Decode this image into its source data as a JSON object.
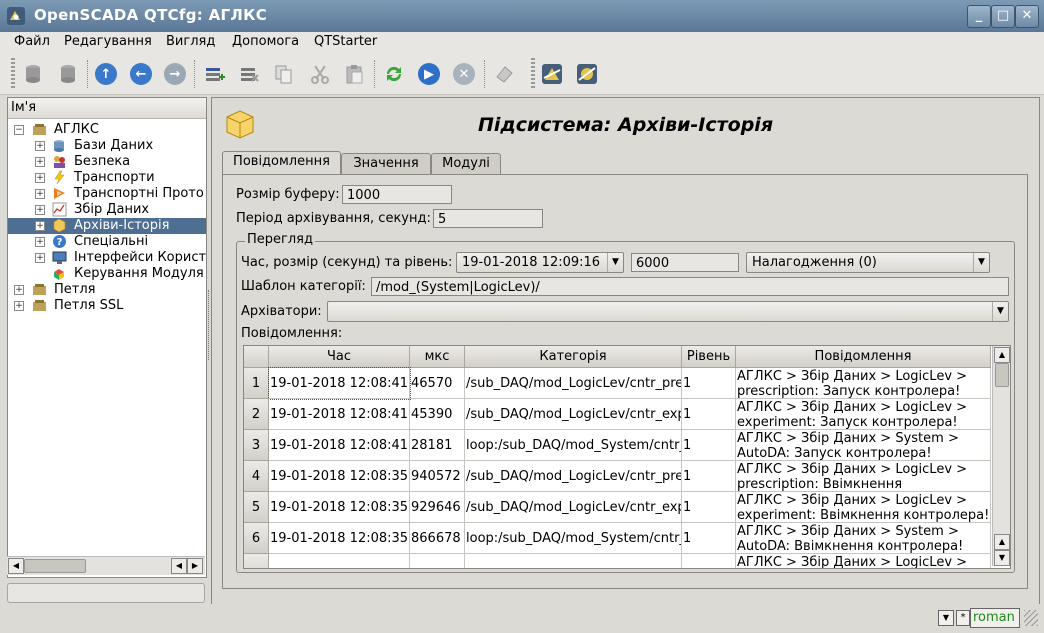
{
  "window": {
    "title": "OpenSCADA QTCfg: АГЛКС"
  },
  "menu": [
    "Файл",
    "Редагування",
    "Вигляд",
    "Допомога",
    "QTStarter"
  ],
  "tree": {
    "header": "Ім'я",
    "items": [
      {
        "label": "АГЛКС",
        "level": 0
      },
      {
        "label": "Бази Даних",
        "level": 1
      },
      {
        "label": "Безпека",
        "level": 1
      },
      {
        "label": "Транспорти",
        "level": 1
      },
      {
        "label": "Транспортні Прото",
        "level": 1
      },
      {
        "label": "Збір Даних",
        "level": 1
      },
      {
        "label": "Архіви-Історія",
        "level": 1,
        "selected": true
      },
      {
        "label": "Спеціальні",
        "level": 1
      },
      {
        "label": "Інтерфейси Корист",
        "level": 1
      },
      {
        "label": "Керування Модуля",
        "level": 1
      },
      {
        "label": "Петля",
        "level": 0
      },
      {
        "label": "Петля SSL",
        "level": 0
      }
    ]
  },
  "page": {
    "title": "Підсистема: Архіви-Історія",
    "tabs": [
      "Повідомлення",
      "Значення",
      "Модулі"
    ],
    "buffer_label": "Розмір буферу:",
    "buffer_value": "1000",
    "period_label": "Період архівування, секунд:",
    "period_value": "5",
    "view_group": "Перегляд",
    "time_label": "Час, розмір (секунд) та рівень:",
    "time_value": "19-01-2018 12:09:16",
    "size_value": "6000",
    "level_value": "Налагодження (0)",
    "category_label": "Шаблон категорії:",
    "category_value": "/mod_(System|LogicLev)/",
    "archivers_label": "Архіватори:",
    "archivers_value": "",
    "messages_label": "Повідомлення:"
  },
  "table": {
    "columns": [
      "Час",
      "мкс",
      "Категорія",
      "Рівень",
      "Повідомлення"
    ],
    "rows": [
      {
        "n": "1",
        "time": "19-01-2018 12:08:41",
        "us": "46570",
        "cat": "/sub_DAQ/mod_LogicLev/cntr_pre",
        "level": "1",
        "msg": "АГЛКС > Збір Даних > LogicLev > prescription: Запуск контролера!"
      },
      {
        "n": "2",
        "time": "19-01-2018 12:08:41",
        "us": "45390",
        "cat": "/sub_DAQ/mod_LogicLev/cntr_exp",
        "level": "1",
        "msg": "АГЛКС > Збір Даних > LogicLev > experiment: Запуск контролера!"
      },
      {
        "n": "3",
        "time": "19-01-2018 12:08:41",
        "us": "28181",
        "cat": "loop:/sub_DAQ/mod_System/cntr_",
        "level": "1",
        "msg": "АГЛКС > Збір Даних > System > AutoDA: Запуск контролера!"
      },
      {
        "n": "4",
        "time": "19-01-2018 12:08:35",
        "us": "940572",
        "cat": "/sub_DAQ/mod_LogicLev/cntr_pre",
        "level": "1",
        "msg": "АГЛКС > Збір Даних > LogicLev > prescription: Ввімкнення контролера!"
      },
      {
        "n": "5",
        "time": "19-01-2018 12:08:35",
        "us": "929646",
        "cat": "/sub_DAQ/mod_LogicLev/cntr_exp",
        "level": "1",
        "msg": "АГЛКС > Збір Даних > LogicLev > experiment: Ввімкнення контролера!"
      },
      {
        "n": "6",
        "time": "19-01-2018 12:08:35",
        "us": "866678",
        "cat": "loop:/sub_DAQ/mod_System/cntr_",
        "level": "1",
        "msg": "АГЛКС > Збір Даних > System > AutoDA: Ввімкнення контролера!"
      },
      {
        "n": "",
        "time": "",
        "us": "",
        "cat": "",
        "level": "",
        "msg": "АГЛКС > Збір Даних > LogicLev >"
      }
    ]
  },
  "status": {
    "user": "roman"
  }
}
